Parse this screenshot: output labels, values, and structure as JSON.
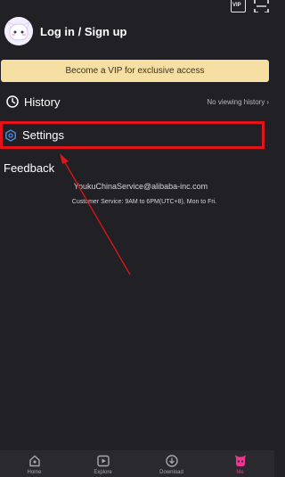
{
  "top_icons": {
    "vip_text": "VIP"
  },
  "profile": {
    "title": "Log in / Sign up"
  },
  "vip_banner": {
    "label": "Become a VIP for exclusive access"
  },
  "history": {
    "label": "History",
    "status": "No viewing history",
    "chevron": "›"
  },
  "settings": {
    "label": "Settings"
  },
  "feedback": {
    "label": "Feedback"
  },
  "contact": {
    "email": "YoukuChinaService@alibaba-inc.com",
    "hours": "Customer Service: 9AM to 6PM(UTC+8), Mon to Fri."
  },
  "tabs": [
    {
      "label": "Home",
      "icon": "home-icon"
    },
    {
      "label": "Explore",
      "icon": "play-square-icon"
    },
    {
      "label": "Download",
      "icon": "download-icon"
    },
    {
      "label": "Me",
      "icon": "mascot-face-icon",
      "active": true
    }
  ],
  "colors": {
    "background": "#212024",
    "vip_banner": "#f6dfa2",
    "highlight_box": "#e0141b",
    "active_tab": "#f0358f",
    "settings_icon": "#4a90e2"
  }
}
